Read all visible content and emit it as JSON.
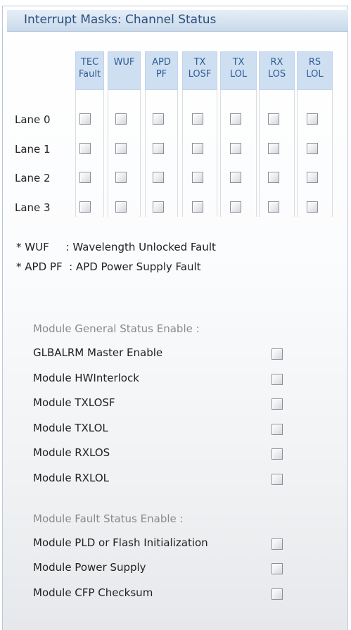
{
  "panel": {
    "title": "Interrupt Masks: Channel Status"
  },
  "grid": {
    "columns": [
      {
        "line1": "TEC",
        "line2": "Fault"
      },
      {
        "line1": "WUF",
        "line2": ""
      },
      {
        "line1": "APD",
        "line2": "PF"
      },
      {
        "line1": "TX",
        "line2": "LOSF"
      },
      {
        "line1": "TX",
        "line2": "LOL"
      },
      {
        "line1": "RX",
        "line2": "LOS"
      },
      {
        "line1": "RS",
        "line2": "LOL"
      }
    ],
    "lanes": [
      "Lane 0",
      "Lane 1",
      "Lane 2",
      "Lane 3"
    ]
  },
  "notes": [
    "* WUF     : Wavelength Unlocked Fault",
    "* APD PF  : APD Power Supply Fault"
  ],
  "general_status": {
    "label": "Module General Status Enable :",
    "items": [
      "GLBALRM Master Enable",
      "Module HWInterlock",
      "Module TXLOSF",
      "Module TXLOL",
      "Module RXLOS",
      "Module RXLOL"
    ]
  },
  "fault_status": {
    "label": "Module Fault Status Enable :",
    "items": [
      "Module PLD or Flash Initialization",
      "Module Power Supply",
      "Module CFP Checksum"
    ]
  }
}
